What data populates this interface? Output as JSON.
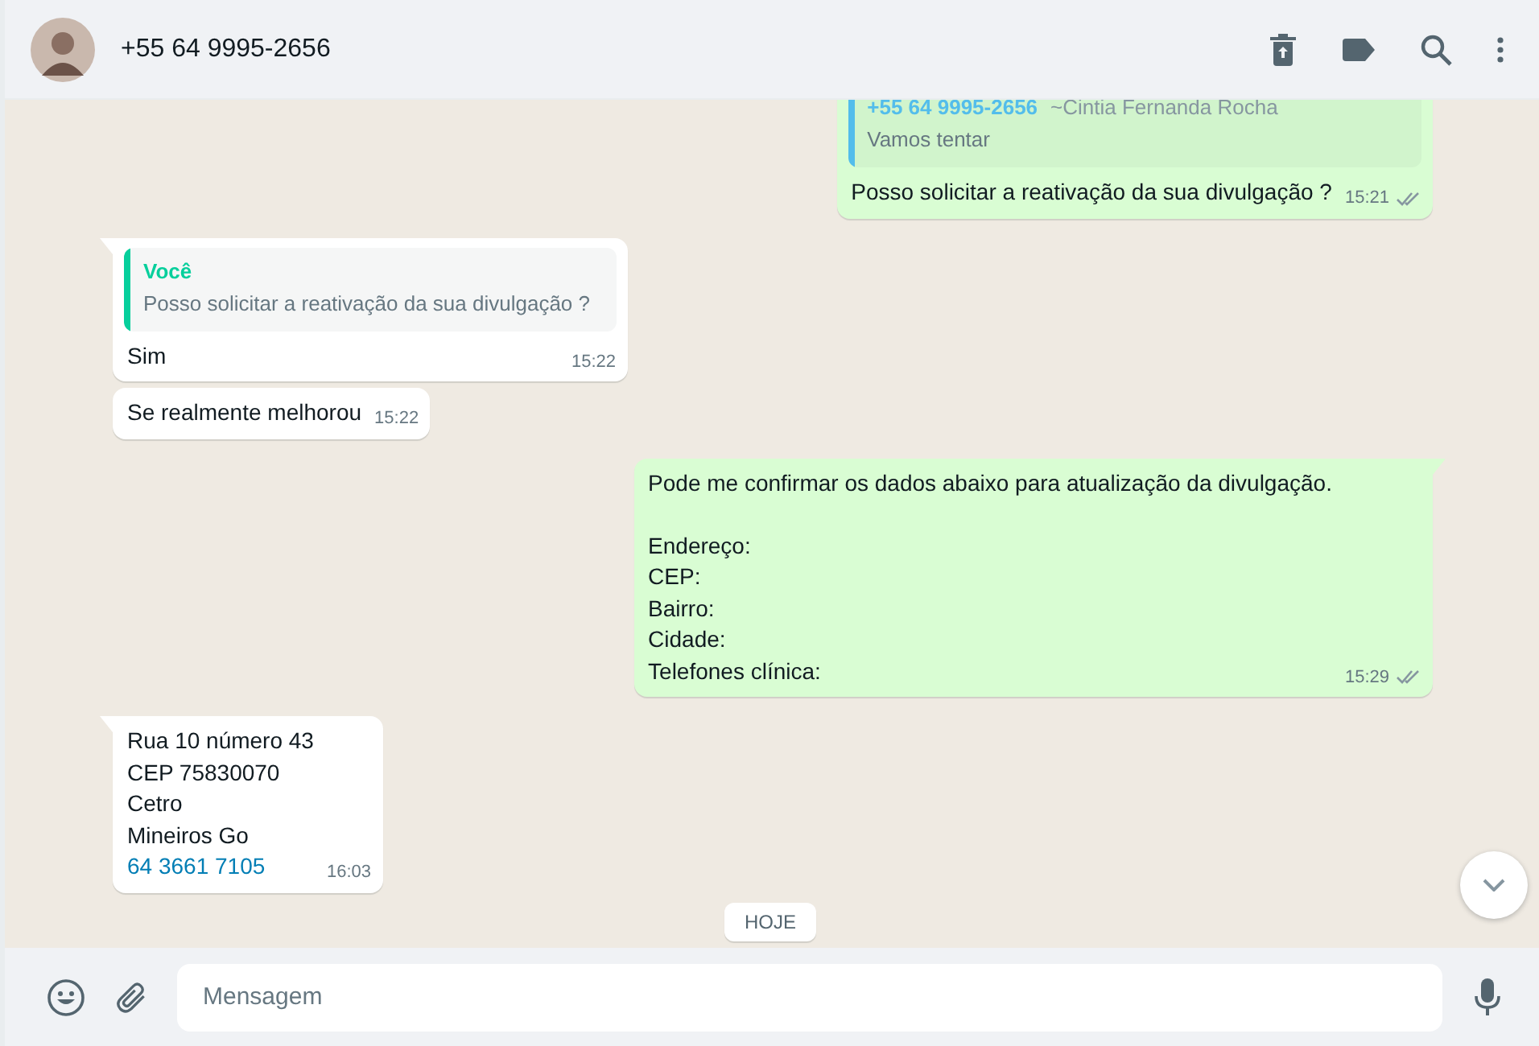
{
  "header": {
    "contact": "+55 64 9995-2656"
  },
  "messages": [
    {
      "kind": "out",
      "quote": {
        "author": "+55 64 9995-2656",
        "author_name": "~Cintia Fernanda Rocha",
        "text": "Vamos tentar",
        "color": "#53bdeb"
      },
      "text": "Posso solicitar a reativação da sua divulgação ?",
      "time": "15:21",
      "read": false
    },
    {
      "kind": "in",
      "tail": true,
      "quote": {
        "author": "Você",
        "text": "Posso solicitar a reativação da sua divulgação ?",
        "color": "#06cf9c"
      },
      "text": "Sim",
      "time": "15:22"
    },
    {
      "kind": "in",
      "tail": false,
      "text": "Se realmente melhorou",
      "time": "15:22"
    },
    {
      "kind": "out",
      "tail": true,
      "text": "Pode me confirmar os dados abaixo para atualização da divulgação.\n\nEndereço:\nCEP:\nBairro:\nCidade:\nTelefones clínica:",
      "time": "15:29",
      "read": false
    },
    {
      "kind": "in",
      "tail": true,
      "text": "Rua 10 número 43\nCEP 75830070\nCetro\nMineiros Go",
      "phone": "64 3661 7105",
      "time": "16:03"
    }
  ],
  "date_divider": "HOJE",
  "composer": {
    "placeholder": "Mensagem"
  }
}
